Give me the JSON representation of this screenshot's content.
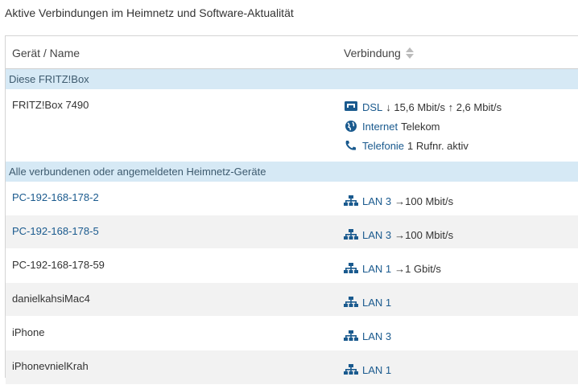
{
  "title": "Aktive Verbindungen im Heimnetz und Software-Aktualität",
  "table": {
    "col_device": "Gerät / Name",
    "col_connection": "Verbindung"
  },
  "colors": {
    "link": "#1a5a8e",
    "section_bg": "#d6e9f5",
    "alt_row": "#f2f2f2"
  },
  "box_section": {
    "label": "Diese FRITZ!Box",
    "device": "FRITZ!Box 7490",
    "connections": [
      {
        "icon": "dsl-icon",
        "label": "DSL",
        "detail": "↓ 15,6 Mbit/s ↑ 2,6 Mbit/s"
      },
      {
        "icon": "globe-icon",
        "label": "Internet",
        "detail": "Telekom"
      },
      {
        "icon": "phone-icon",
        "label": "Telefonie",
        "detail": "1 Rufnr. aktiv"
      }
    ]
  },
  "devices_section": {
    "label": "Alle verbundenen oder angemeldeten Heimnetz-Geräte",
    "rows": [
      {
        "name": "PC-192-168-178-2",
        "link": true,
        "port": "LAN 3",
        "speed": "→100 Mbit/s"
      },
      {
        "name": "PC-192-168-178-5",
        "link": true,
        "port": "LAN 3",
        "speed": "→100 Mbit/s"
      },
      {
        "name": "PC-192-168-178-59",
        "link": false,
        "port": "LAN 1",
        "speed": "→1 Gbit/s"
      },
      {
        "name": "danielkahsiMac4",
        "link": false,
        "port": "LAN 1",
        "speed": ""
      },
      {
        "name": "iPhone",
        "link": false,
        "port": "LAN 3",
        "speed": ""
      },
      {
        "name": "iPhonevnielKrah",
        "link": false,
        "port": "LAN 1",
        "speed": ""
      }
    ]
  }
}
